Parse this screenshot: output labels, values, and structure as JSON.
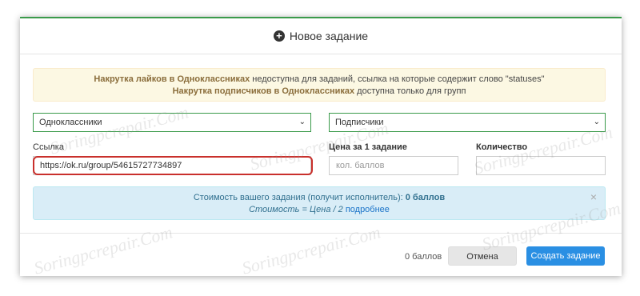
{
  "header": {
    "title": "Новое задание"
  },
  "warning": {
    "line1_bold": "Накрутка лайков в Одноклассниках",
    "line1_rest": " недоступна для заданий, ссылка на которые содержит слово \"statuses\"",
    "line2_bold": "Накрутка подписчиков в Одноклассниках",
    "line2_rest": " доступна только для групп"
  },
  "form": {
    "network_select": "Одноклассники",
    "type_select": "Подписчики",
    "link_label": "Ссылка",
    "link_value": "https://ok.ru/group/54615727734897",
    "price_label": "Цена за 1 задание",
    "price_placeholder": "кол. баллов",
    "qty_label": "Количество"
  },
  "info": {
    "cost_text": "Стоимость вашего задания (получит исполнитель): ",
    "cost_value": "0 баллов",
    "formula": "Стоимость = Цена / 2 ",
    "more_link": "подробнее"
  },
  "footer": {
    "points": "0 баллов",
    "cancel_label": "Отмена",
    "create_label": "Создать задание"
  },
  "watermark": "Soringpcrepair.Com",
  "colors": {
    "accent": "#3a9a4a",
    "primary_button": "#2a8fe3",
    "highlight": "#c9302c"
  }
}
